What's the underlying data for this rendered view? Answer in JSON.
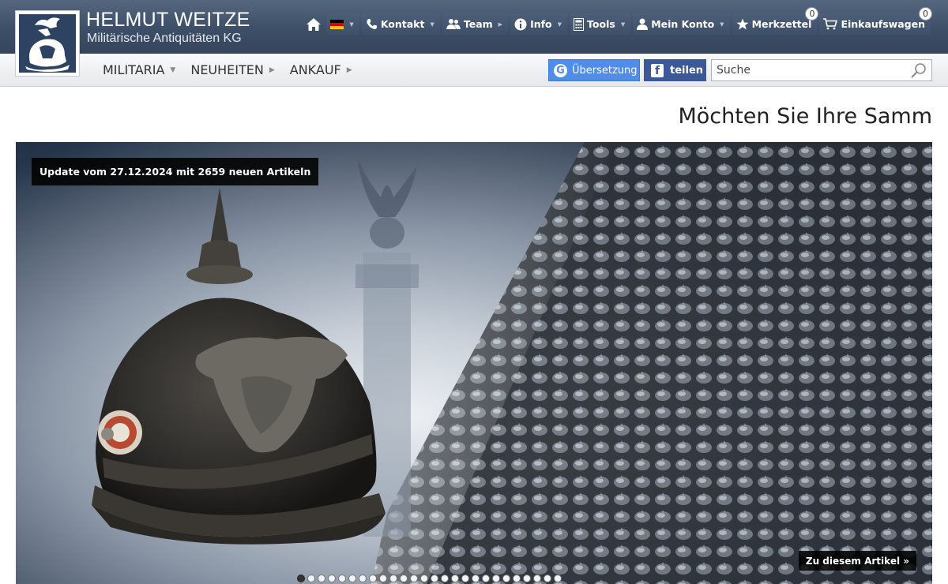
{
  "brand": {
    "name": "HELMUT WEITZE",
    "subtitle": "Militärische Antiquitäten KG"
  },
  "topnav": {
    "home_icon": "home-icon",
    "language_flag": "flag-de-icon",
    "items": [
      {
        "label": "Kontakt",
        "icon": "phone-icon"
      },
      {
        "label": "Team",
        "icon": "team-icon"
      },
      {
        "label": "Info",
        "icon": "info-icon"
      },
      {
        "label": "Tools",
        "icon": "calculator-icon"
      },
      {
        "label": "Mein Konto",
        "icon": "user-icon"
      }
    ],
    "watchlist": {
      "label": "Merkzettel",
      "count": "0",
      "icon": "star-icon"
    },
    "cart": {
      "label": "Einkaufswagen",
      "count": "0",
      "icon": "cart-icon"
    }
  },
  "menu": {
    "items": [
      {
        "label": "MILITARIA",
        "caret": "down"
      },
      {
        "label": "NEUHEITEN",
        "caret": "right"
      },
      {
        "label": "ANKAUF",
        "caret": "right"
      }
    ]
  },
  "actions": {
    "translate_label": "Übersetzung",
    "share_label": "teilen"
  },
  "search": {
    "placeholder": "Suche"
  },
  "headline": "Möchten Sie Ihre Samm",
  "hero": {
    "update_text": "Update vom 27.12.2024 mit 2659 neuen Artikeln",
    "article_link": "Zu diesem Artikel »",
    "slide_count": 26,
    "active_slide": 1
  },
  "colors": {
    "header_dark": "#3d4e67",
    "translate_blue": "#4f8de8",
    "facebook_blue": "#3b5998"
  }
}
